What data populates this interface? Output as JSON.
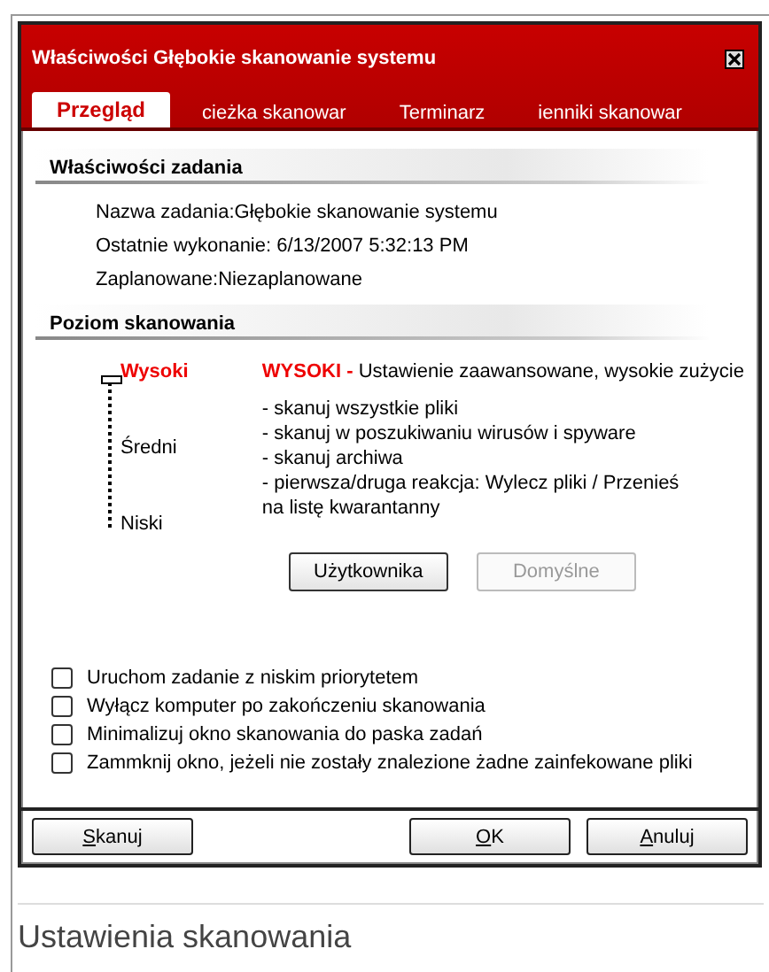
{
  "window": {
    "title": "Właściwości Głębokie skanowanie systemu"
  },
  "tabs": [
    {
      "label": "Przegląd",
      "selected": true
    },
    {
      "label": "cieżka skanowar",
      "selected": false
    },
    {
      "label": "Terminarz",
      "selected": false
    },
    {
      "label": "ienniki skanowar",
      "selected": false
    }
  ],
  "task_properties": {
    "heading": "Właściwości zadania",
    "lines": [
      "Nazwa zadania:Głębokie skanowanie systemu",
      "Ostatnie wykonanie: 6/13/2007 5:32:13 PM",
      "Zaplanowane:Niezaplanowane"
    ]
  },
  "scan_level": {
    "heading": "Poziom skanowania",
    "levels": [
      {
        "label": "Wysoki",
        "selected": true
      },
      {
        "label": "Średni",
        "selected": false
      },
      {
        "label": "Niski",
        "selected": false
      }
    ],
    "level_name": "WYSOKI -",
    "description": "Ustawienie zaawansowane, wysokie zużycie",
    "details": [
      "- skanuj wszystkie pliki",
      "- skanuj w poszukiwaniu wirusów i spyware",
      "- skanuj archiwa",
      "- pierwsza/druga reakcja: Wylecz pliki / Przenieś\nna listę kwarantanny"
    ],
    "buttons": [
      {
        "label": "Użytkownika",
        "disabled": false
      },
      {
        "label": "Domyślne",
        "disabled": true
      }
    ]
  },
  "options": [
    {
      "label": "Uruchom zadanie z niskim priorytetem",
      "checked": false
    },
    {
      "label": "Wyłącz komputer po zakończeniu skanowania",
      "checked": false
    },
    {
      "label": "Minimalizuj okno skanowania do paska zadań",
      "checked": false
    },
    {
      "label": "Zammknij okno, jeżeli nie zostały znalezione żadne zainfekowane pliki",
      "checked": false
    }
  ],
  "footer_buttons": [
    {
      "label": "Skanuj",
      "kind": "left"
    },
    {
      "label": "OK",
      "kind": "right"
    },
    {
      "label": "Anuluj",
      "kind": "right"
    }
  ],
  "caption": "Ustawienia skanowania"
}
